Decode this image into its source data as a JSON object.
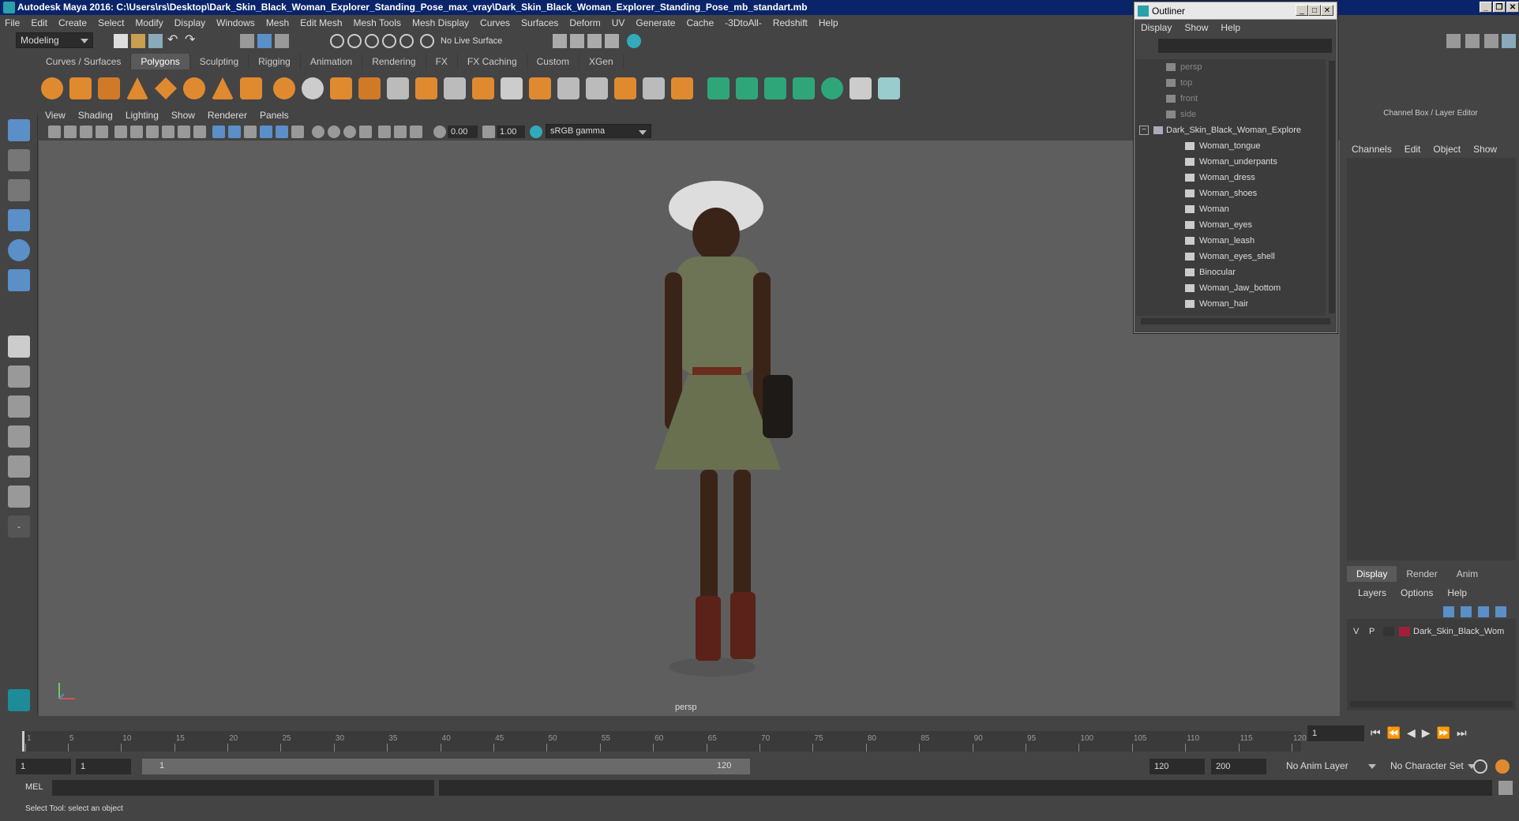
{
  "window": {
    "title": "Autodesk Maya 2016: C:\\Users\\rs\\Desktop\\Dark_Skin_Black_Woman_Explorer_Standing_Pose_max_vray\\Dark_Skin_Black_Woman_Explorer_Standing_Pose_mb_standart.mb"
  },
  "menubar": [
    "File",
    "Edit",
    "Create",
    "Select",
    "Modify",
    "Display",
    "Windows",
    "Mesh",
    "Edit Mesh",
    "Mesh Tools",
    "Mesh Display",
    "Curves",
    "Surfaces",
    "Deform",
    "UV",
    "Generate",
    "Cache",
    "-3DtoAll-",
    "Redshift",
    "Help"
  ],
  "status": {
    "mode": "Modeling",
    "live_surface": "No Live Surface"
  },
  "shelf": {
    "tabs": [
      "Curves / Surfaces",
      "Polygons",
      "Sculpting",
      "Rigging",
      "Animation",
      "Rendering",
      "FX",
      "FX Caching",
      "Custom",
      "XGen"
    ],
    "active": "Polygons"
  },
  "panel": {
    "menu": [
      "View",
      "Shading",
      "Lighting",
      "Show",
      "Renderer",
      "Panels"
    ],
    "exposure": "0.00",
    "gamma": "1.00",
    "color_space": "sRGB gamma",
    "camera_label": "persp"
  },
  "outliner": {
    "title": "Outliner",
    "menu": [
      "Display",
      "Show",
      "Help"
    ],
    "cameras": [
      "persp",
      "top",
      "front",
      "side"
    ],
    "group": "Dark_Skin_Black_Woman_Explore",
    "children": [
      "Woman_tongue",
      "Woman_underpants",
      "Woman_dress",
      "Woman_shoes",
      "Woman",
      "Woman_eyes",
      "Woman_leash",
      "Woman_eyes_shell",
      "Binocular",
      "Woman_Jaw_bottom",
      "Woman_hair"
    ]
  },
  "channelbox": {
    "title": "Channel Box / Layer Editor",
    "menu": [
      "Channels",
      "Edit",
      "Object",
      "Show"
    ],
    "tabs": [
      "Display",
      "Render",
      "Anim"
    ],
    "active_tab": "Display",
    "layer_menu": [
      "Layers",
      "Options",
      "Help"
    ],
    "layer": {
      "v": "V",
      "p": "P",
      "name": "Dark_Skin_Black_Wom",
      "color": "#a0203a"
    }
  },
  "timeline": {
    "ticks": [
      "1",
      "5",
      "10",
      "15",
      "20",
      "25",
      "30",
      "35",
      "40",
      "45",
      "50",
      "55",
      "60",
      "65",
      "70",
      "75",
      "80",
      "85",
      "90",
      "95",
      "100",
      "105",
      "110",
      "115",
      "120"
    ],
    "current_frame": "1"
  },
  "range": {
    "start": "1",
    "anim_start": "1",
    "slider_start": "1",
    "slider_end": "120",
    "anim_end": "120",
    "end": "200",
    "anim_layer": "No Anim Layer",
    "char_set": "No Character Set"
  },
  "cmdline": {
    "label": "MEL"
  },
  "helpline": {
    "text": "Select Tool: select an object"
  }
}
